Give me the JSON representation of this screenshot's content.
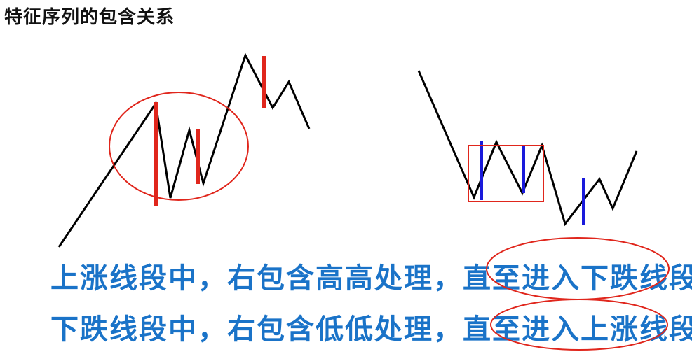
{
  "title": "特征序列的包含关系",
  "rules": [
    "上涨线段中，右包含高高处理，直至进入下跌线段",
    "下跌线段中，右包含低低处理，直至进入上涨线段"
  ],
  "colors": {
    "price_line": "#000000",
    "red_bar": "#e0261c",
    "blue_bar": "#1a1adb",
    "ellipse_stroke": "#e0261c",
    "box_stroke": "#e0261c",
    "rule_text": "#1a73c8"
  }
}
